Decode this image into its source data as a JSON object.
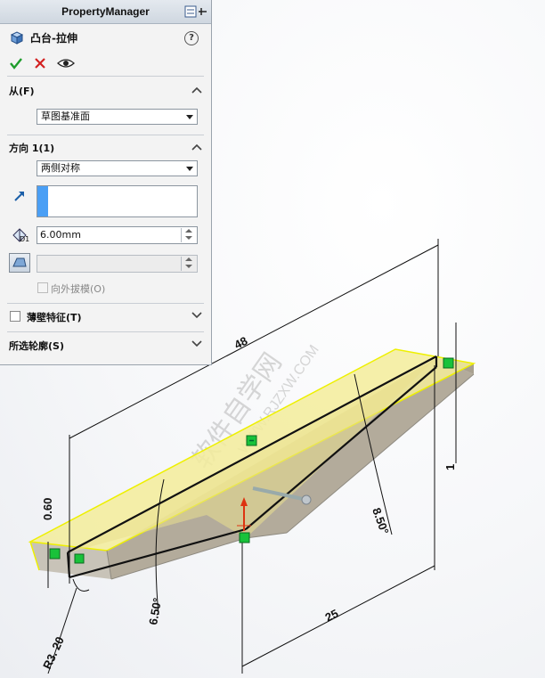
{
  "property_manager": {
    "title": "PropertyManager",
    "feature_name": "凸台-拉伸",
    "help_label": "?",
    "from_section": {
      "label": "从(F)",
      "dropdown_value": "草图基准面"
    },
    "direction_section": {
      "label": "方向 1(1)",
      "end_condition": "两侧对称",
      "depth_value": "6.00mm",
      "depth_icon_label": "D1",
      "draft_value": "",
      "draft_outward_label": "向外拔模(O)"
    },
    "thin_feature_label": "薄壁特征(T)",
    "selected_contours_label": "所选轮廓(S)"
  },
  "dimensions": {
    "total_length": "48",
    "partial_length": "25",
    "thickness": "0.60",
    "height_right": "1",
    "angle_left": "6.50°",
    "angle_right": "8.50°",
    "radius": "R3. 20"
  },
  "watermark": {
    "line1": "软件自学网",
    "line2": "WWW.RJZXW.COM"
  },
  "colors": {
    "accept": "#1e9d2c",
    "cancel": "#d32020",
    "preview_fill": "#f3ec9a",
    "preview_edge": "#f3f300",
    "solid_face": "#b2aa9a",
    "relation_green": "#19c23a"
  }
}
